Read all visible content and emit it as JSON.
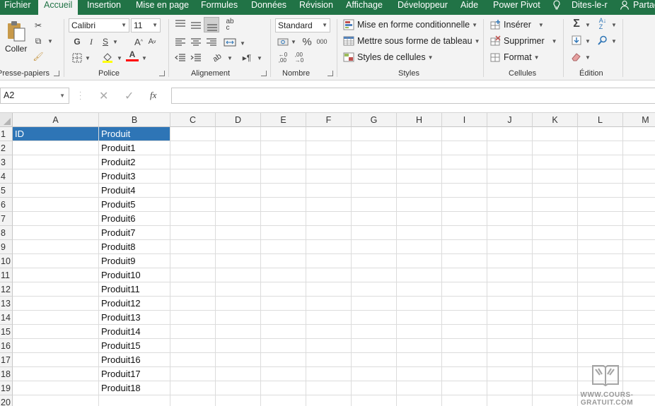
{
  "tabs": {
    "fichier": "Fichier",
    "accueil": "Accueil",
    "insertion": "Insertion",
    "mise_en_page": "Mise en page",
    "formules": "Formules",
    "donnees": "Données",
    "revision": "Révision",
    "affichage": "Affichage",
    "developpeur": "Développeur",
    "aide": "Aide",
    "power_pivot": "Power Pivot",
    "tell_me": "Dites-le-r",
    "share": "Partag"
  },
  "ribbon": {
    "clipboard": {
      "paste_label": "Coller",
      "group_label": "Presse-papiers"
    },
    "font": {
      "font_name": "Calibri",
      "font_size": "11",
      "group_label": "Police"
    },
    "alignment": {
      "group_label": "Alignement"
    },
    "number": {
      "format": "Standard",
      "group_label": "Nombre"
    },
    "styles": {
      "conditional_formatting": "Mise en forme conditionnelle",
      "format_as_table": "Mettre sous forme de tableau",
      "cell_styles": "Styles de cellules",
      "group_label": "Styles"
    },
    "cells": {
      "insert": "Insérer",
      "delete": "Supprimer",
      "format": "Format",
      "group_label": "Cellules"
    },
    "editing": {
      "group_label": "Édition"
    }
  },
  "formula_bar": {
    "name_box": "A2",
    "fx": "fx",
    "formula": ""
  },
  "columns": [
    "A",
    "B",
    "C",
    "D",
    "E",
    "F",
    "G",
    "H",
    "I",
    "J",
    "K",
    "L",
    "M"
  ],
  "rows": [
    "1",
    "2",
    "3",
    "4",
    "5",
    "6",
    "7",
    "8",
    "9",
    "10",
    "11",
    "12",
    "13",
    "14",
    "15",
    "16",
    "17",
    "18",
    "19",
    "20"
  ],
  "cells": {
    "A1": "ID",
    "B1": "Produit",
    "B": [
      "Produit1",
      "Produit2",
      "Produit3",
      "Produit4",
      "Produit5",
      "Produit6",
      "Produit7",
      "Produit8",
      "Produit9",
      "Produit10",
      "Produit11",
      "Produit12",
      "Produit13",
      "Produit14",
      "Produit15",
      "Produit16",
      "Produit17",
      "Produit18"
    ]
  },
  "watermark": {
    "text": "WWW.COURS-GRATUIT.COM"
  },
  "colors": {
    "excel_green": "#217346",
    "header_blue": "#2e75b6"
  }
}
